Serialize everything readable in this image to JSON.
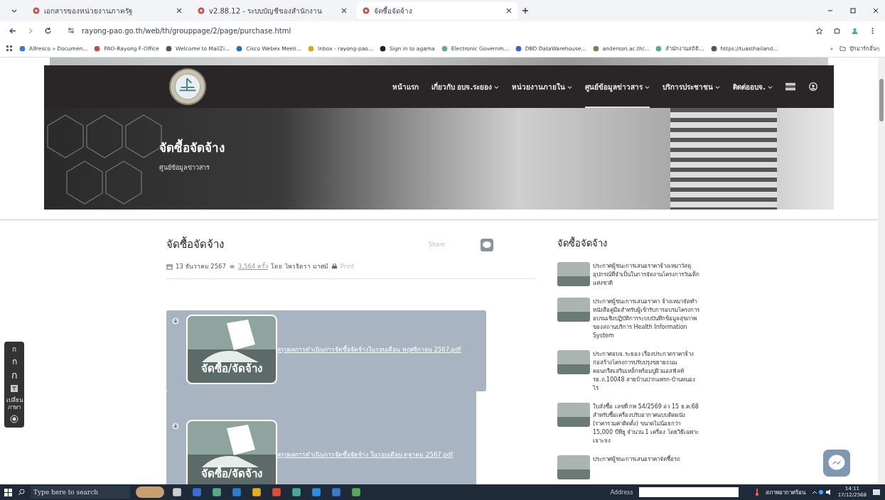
{
  "browser": {
    "tabs": [
      {
        "title": "เอกสารของหน่วยงานภาครัฐ",
        "selected": false
      },
      {
        "title": "v2.88.12 - ระบบบัญชีของสำนักงาน",
        "selected": false
      },
      {
        "title": "จัดซื้อจัดจ้าง",
        "selected": true
      }
    ],
    "address": "rayong-pao.go.th/web/th/grouppage/2/page/purchase.html",
    "bookmarks": [
      "Alfresco » Documen...",
      "PAO-Rayong F-Office",
      "Welcome to MailZi...",
      "Cisco Webex Meeti...",
      "Inbox - rayong-pao...",
      "Sign in to agama",
      "Electronic Governm...",
      "DBD DataWarehouse...",
      "anderson.ac.th/...",
      "สำนักงานสถิติ...",
      "https://tuasthailand..."
    ],
    "bookmarks_more": "»",
    "other_bookmarks": "บุ๊กมาร์กอื่นๆ"
  },
  "site": {
    "nav": [
      {
        "label": "หน้าแรก",
        "dropdown": false,
        "selected": false
      },
      {
        "label": "เกี่ยวกับ อบจ.ระยอง",
        "dropdown": true,
        "selected": false
      },
      {
        "label": "หน่วยงานภายใน",
        "dropdown": true,
        "selected": false
      },
      {
        "label": "ศูนย์ข้อมูลข่าวสาร",
        "dropdown": true,
        "selected": true
      },
      {
        "label": "บริการประชาชน",
        "dropdown": true,
        "selected": false
      },
      {
        "label": "ติดต่ออบจ.",
        "dropdown": true,
        "selected": false
      }
    ],
    "banner": {
      "title": "จัดซื้อจัดจ้าง",
      "subtitle": "ศูนย์ข้อมูลข่าวสาร"
    }
  },
  "article": {
    "title": "จัดซื้อจัดจ้าง",
    "date": "13 ธันวาคม 2567",
    "views": "3,564 ครั้ง",
    "author_prefix": "โดย",
    "author": "ไพรจิตรา มาศมี",
    "print": "Print",
    "share": "Share",
    "files": [
      {
        "name": "สรุปผลการดำเนินการจัดซื้อจัดจ้างในรอบเดือน พฤศจิกายน 2567.pdf",
        "image_label": "จัดซื้อ/จัดจ้าง"
      },
      {
        "name": "สรุปผลการดำเนินการจัดซื้อจัดจ้าง ในรอบเดือน ตุลาคม 2567.pdf",
        "image_label": "จัดซื้อ/จัดจ้าง"
      }
    ]
  },
  "sidebar": {
    "title": "จัดซื้อจัดจ้าง",
    "items": [
      "ประกาศผู้ชนะการเสนอราคาจ้างเหมาวัสดุอุปกรณ์ที่จำเป็นในการจัดงานโครงการวันเด็กแห่งชาติ",
      "ประกาศผู้ชนะการเสนอราคา จ้างเหมาจัดทำหนังสือคู่มือสำหรับผู้เข้ารับการอบรมโครงการอบรมเชิงปฏิบัติการระบบบันทึกข้อมูลสุขภาพของสถานบริการ Health Information System",
      "ประกาศอบจ.ระยอง เรื่องประกวดราคาจ้างก่อสร้างโครงการปรับปรุงขยายถนนคอนกรีตเสริมเหล็กพร้อมปูผิวแอสฟัลท์ รย.ถ.10048 สายบ้านปากแพรก-บ้านหนองไร่",
      "ใบสั่งซื้อ เลขที่ กพ 54/2569 ลว 15 ธ.ค.68 สำหรับซื้อเครื่องปรับอากาศแบบติดผนัง (ราคารวมค่าติดตั้ง) ขนาดไม่น้อยกว่า 15,000 บีทียู จำนวน 1 เครื่อง โดยวิธีเฉพาะเจาะจง",
      "ประกาศผู้ชนะการเสนอราคาจัดซื้อรถ"
    ]
  },
  "font_tools": [
    "ก",
    "ก",
    "ก"
  ],
  "language_label": "เปลี่ยนภาษา",
  "taskbar": {
    "search_placeholder": "Type here to search",
    "address_label": "Address",
    "weather": "สภาพอากาศร้อน",
    "time": "14:11",
    "date": "17/12/2568"
  }
}
